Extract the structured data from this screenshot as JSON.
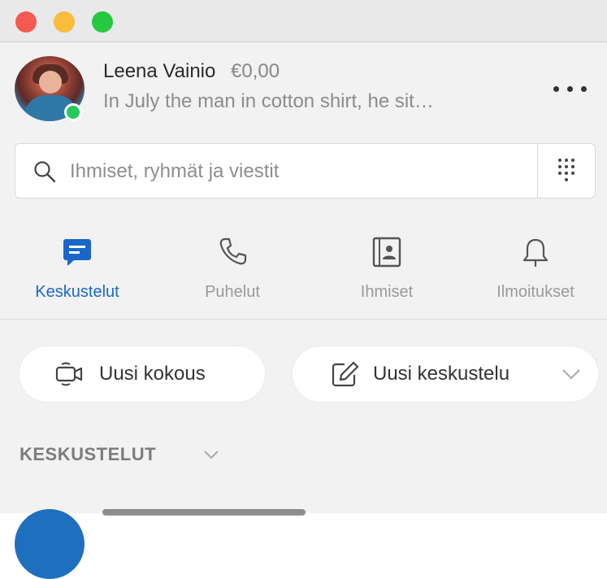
{
  "window": {
    "controls": {
      "close_color": "#f45952",
      "minimize_color": "#f8bd3b",
      "maximize_color": "#26c840"
    }
  },
  "profile": {
    "name": "Leena  Vainio",
    "balance": "€0,00",
    "mood": "In July the man in cotton shirt, he sit…",
    "status": "online",
    "status_color": "#24c85b"
  },
  "search": {
    "placeholder": "Ihmiset, ryhmät ja viestit",
    "icon": "search-icon",
    "dialpad_icon": "dialpad-icon"
  },
  "tabs": [
    {
      "label": "Keskustelut",
      "icon": "chat-icon",
      "active": true
    },
    {
      "label": "Puhelut",
      "icon": "phone-icon",
      "active": false
    },
    {
      "label": "Ihmiset",
      "icon": "contacts-icon",
      "active": false
    },
    {
      "label": "Ilmoitukset",
      "icon": "bell-icon",
      "active": false
    }
  ],
  "actions": {
    "meeting_label": "Uusi kokous",
    "chat_label": "Uusi keskustelu"
  },
  "section": {
    "title": "KESKUSTELUT"
  },
  "colors": {
    "accent": "#1a67c9",
    "inactive": "#9a9a9a"
  }
}
